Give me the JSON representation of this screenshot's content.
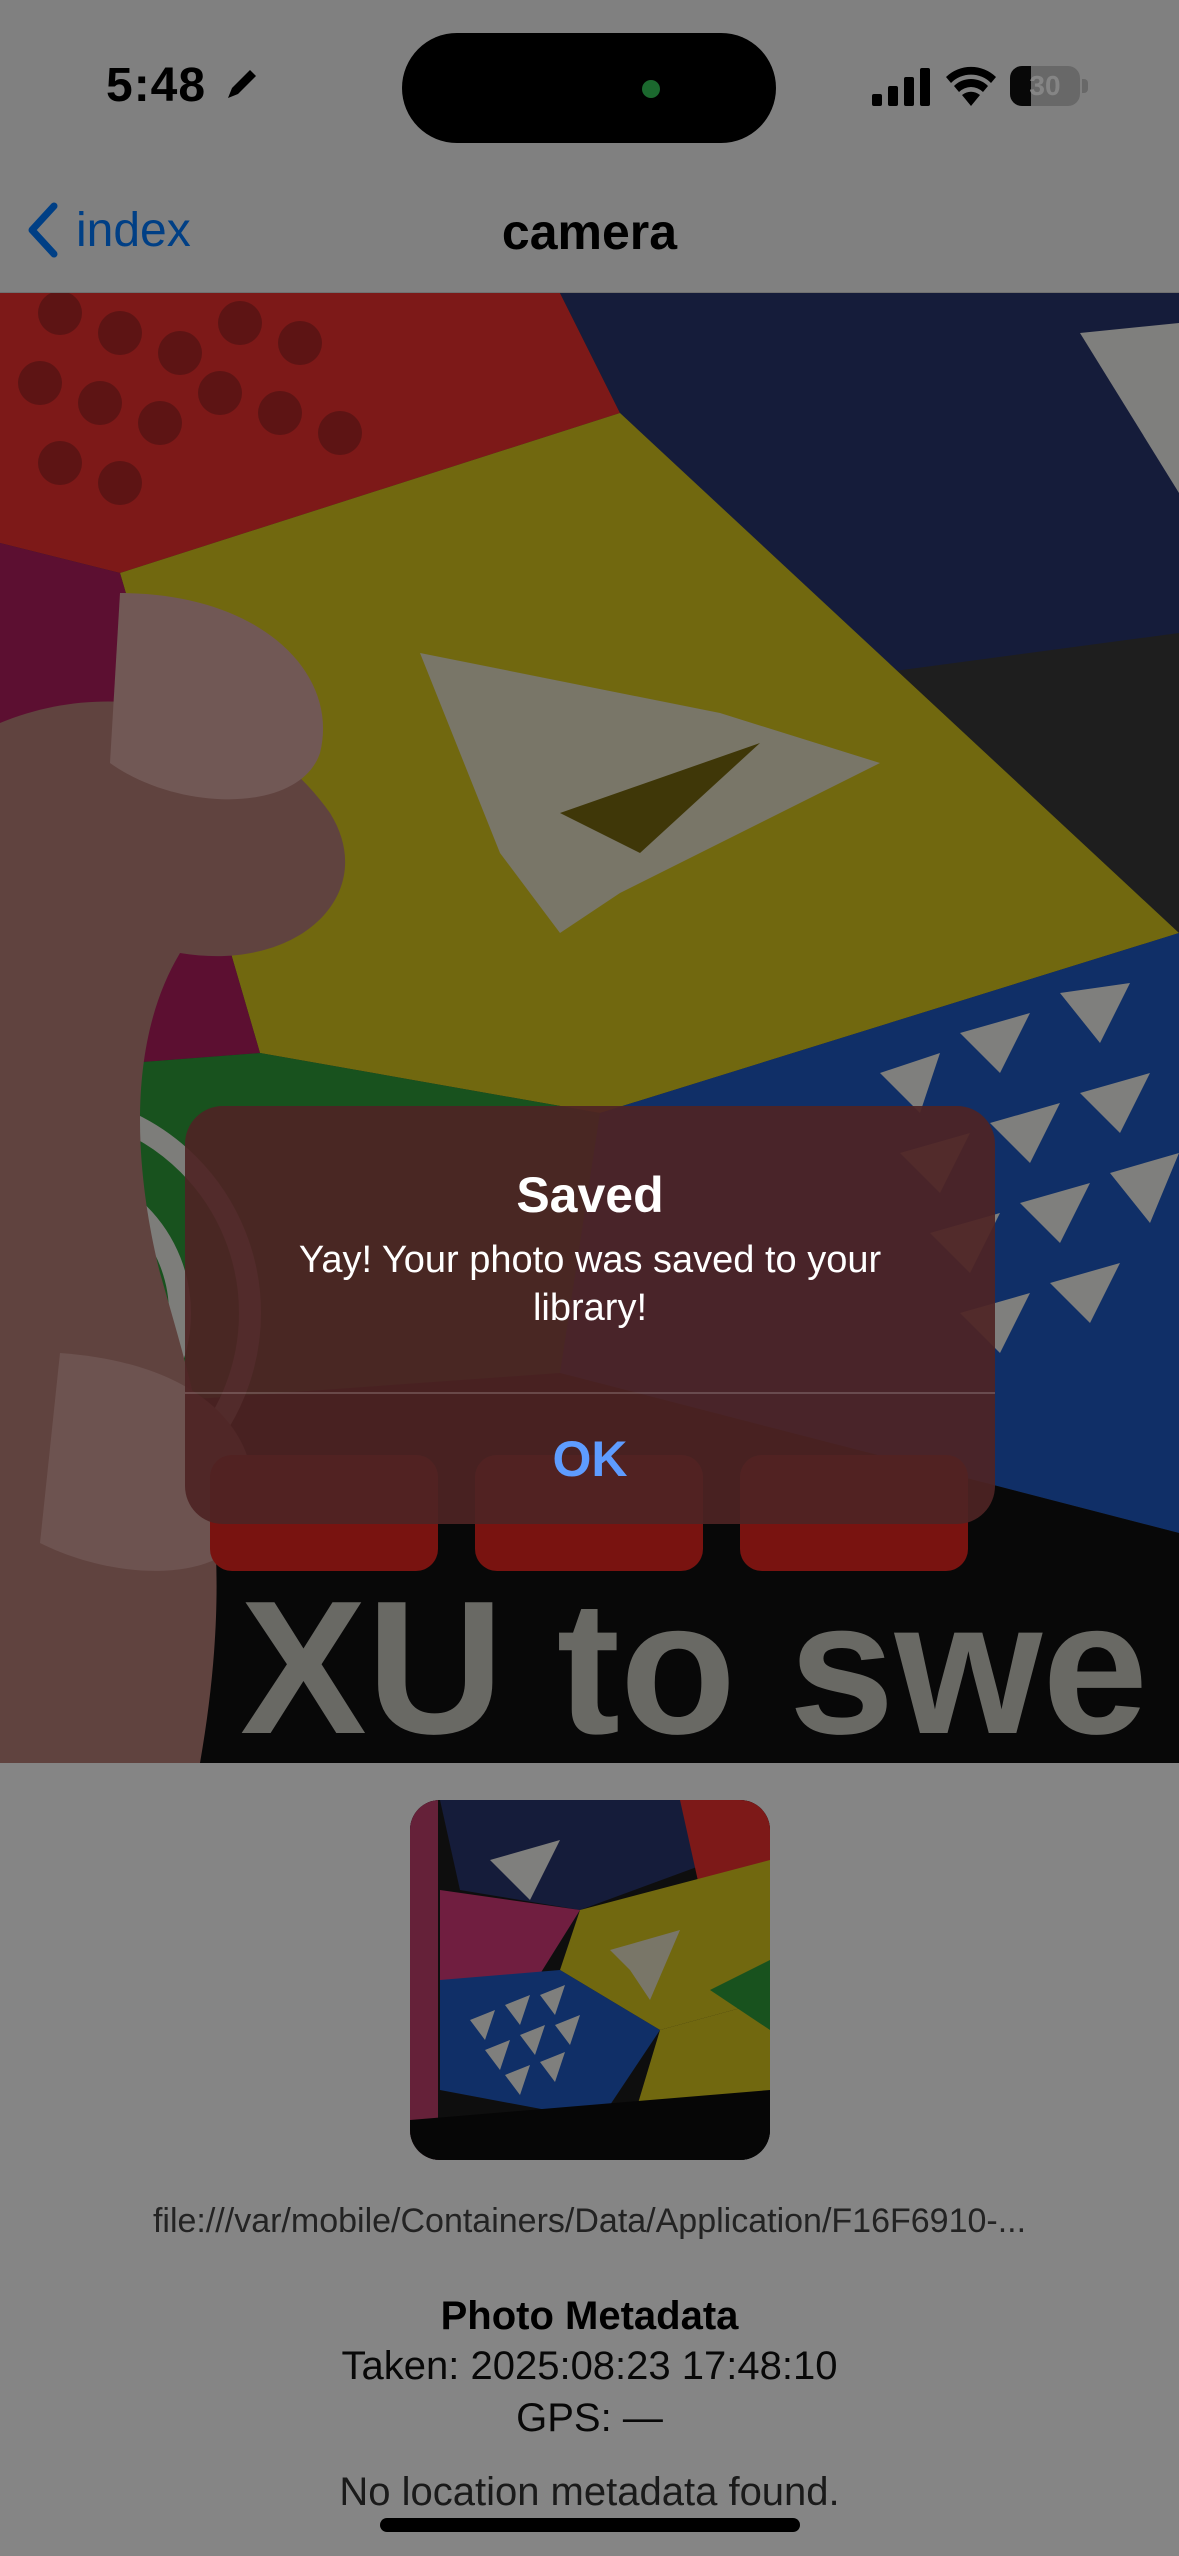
{
  "status_bar": {
    "time": "5:48",
    "battery": "30",
    "battery_level": 0.3
  },
  "nav": {
    "back_label": "index",
    "title": "camera"
  },
  "preview": {
    "photo_text": "XU to swe",
    "shutter_button_count": 3
  },
  "photo": {
    "file_uri": "file:///var/mobile/Containers/Data/Application/F16F6910-..."
  },
  "metadata": {
    "title": "Photo Metadata",
    "taken": "Taken: 2025:08:23 17:48:10",
    "gps": "GPS: —",
    "location_note": "No location metadata found."
  },
  "alert": {
    "title": "Saved",
    "message": "Yay! Your photo was saved to your library!",
    "ok_label": "OK"
  },
  "colors": {
    "accent": "#007aff",
    "alert_button": "#5e9cff",
    "camera_button": "#e8251f",
    "island_indicator": "#34c759"
  }
}
